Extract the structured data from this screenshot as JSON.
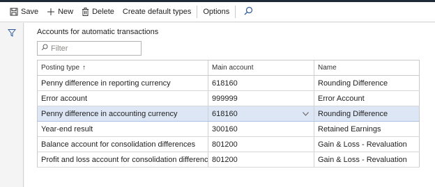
{
  "toolbar": {
    "save_label": "Save",
    "new_label": "New",
    "delete_label": "Delete",
    "create_default_types_label": "Create default types",
    "options_label": "Options"
  },
  "section": {
    "title": "Accounts for automatic transactions"
  },
  "filter": {
    "placeholder": "Filter",
    "value": ""
  },
  "grid": {
    "columns": [
      "Posting type",
      "Main account",
      "Name"
    ],
    "sort_indicator": "↑",
    "rows": [
      {
        "posting_type": "Penny difference in reporting currency",
        "main_account": "618160",
        "name": "Rounding Difference"
      },
      {
        "posting_type": "Error account",
        "main_account": "999999",
        "name": "Error Account"
      },
      {
        "posting_type": "Penny difference in accounting currency",
        "main_account": "618160",
        "name": "Rounding Difference"
      },
      {
        "posting_type": "Year-end result",
        "main_account": "300160",
        "name": "Retained Earnings"
      },
      {
        "posting_type": "Balance account for consolidation differences",
        "main_account": "801200",
        "name": "Gain & Loss - Revaluation"
      },
      {
        "posting_type": "Profit and loss account for consolidation differences",
        "main_account": "801200",
        "name": "Gain & Loss - Revaluation"
      }
    ],
    "selected_row_index": 2
  },
  "colors": {
    "top_bar": "#1e2a38",
    "selected_row": "#dce6f4",
    "accent_icon": "#2b579a"
  },
  "icons": {
    "save": "save-icon",
    "new": "plus-icon",
    "delete": "trash-icon",
    "search": "search-icon",
    "filter": "funnel-icon"
  }
}
